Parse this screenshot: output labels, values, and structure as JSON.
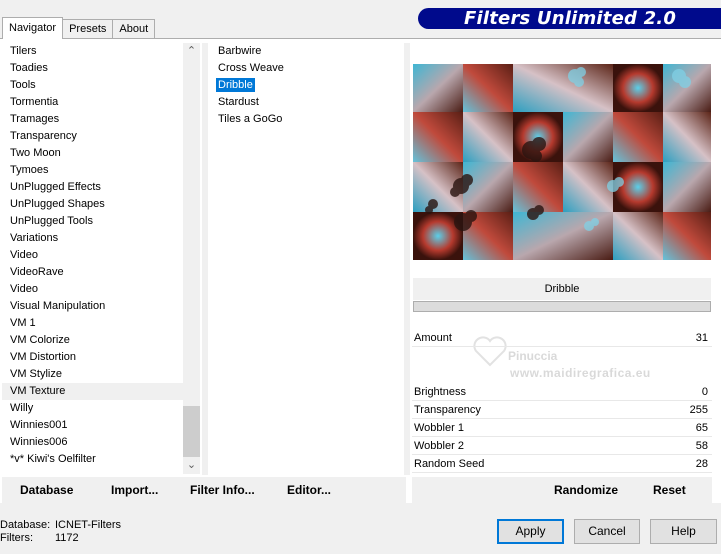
{
  "tabs": [
    "Navigator",
    "Presets",
    "About"
  ],
  "banner_title": "Filters Unlimited 2.0",
  "categories": [
    "Tilers",
    "Toadies",
    "Tools",
    "Tormentia",
    "Tramages",
    "Transparency",
    "Two Moon",
    "Tymoes",
    "UnPlugged Effects",
    "UnPlugged Shapes",
    "UnPlugged Tools",
    "Variations",
    "Video",
    "VideoRave",
    "Video",
    "Visual Manipulation",
    "VM 1",
    "VM Colorize",
    "VM Distortion",
    "VM Stylize",
    "VM Texture",
    "Willy",
    "Winnies001",
    "Winnies006",
    "*v* Kiwi's Oelfilter"
  ],
  "selected_category": "VM Texture",
  "filters": [
    "Barbwire",
    "Cross Weave",
    "Dribble",
    "Stardust",
    "Tiles a GoGo"
  ],
  "selected_filter": "Dribble",
  "filter_name": "Dribble",
  "params": [
    {
      "label": "Amount",
      "value": "31"
    },
    {
      "label": "Brightness",
      "value": "0"
    },
    {
      "label": "Transparency",
      "value": "255"
    },
    {
      "label": "Wobbler 1",
      "value": "65"
    },
    {
      "label": "Wobbler 2",
      "value": "58"
    },
    {
      "label": "Random Seed",
      "value": "28"
    }
  ],
  "watermark": {
    "name": "Pinuccia",
    "site": "www.maidiregrafica.eu"
  },
  "links": {
    "database": "Database",
    "import": "Import...",
    "filter_info": "Filter Info...",
    "editor": "Editor...",
    "randomize": "Randomize",
    "reset": "Reset"
  },
  "status": {
    "database_label": "Database:",
    "database_value": "ICNET-Filters",
    "filters_label": "Filters:",
    "filters_value": "1172"
  },
  "buttons": {
    "apply": "Apply",
    "cancel": "Cancel",
    "help": "Help"
  },
  "colors": {
    "banner": "#000a8c",
    "selection": "#0078d7"
  }
}
